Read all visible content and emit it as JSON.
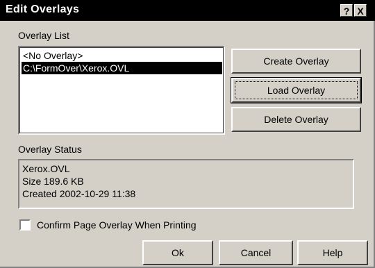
{
  "window": {
    "title": "Edit Overlays",
    "help_button": "?",
    "close_button": "X"
  },
  "overlay_list": {
    "label": "Overlay List",
    "items": [
      "<No Overlay>",
      "C:\\FormOver\\Xerox.OVL"
    ],
    "selected_index": 1
  },
  "side_buttons": {
    "create": "Create Overlay",
    "load": "Load Overlay",
    "delete": "Delete Overlay"
  },
  "status": {
    "label": "Overlay Status",
    "lines": [
      "Xerox.OVL",
      "Size 189.6 KB",
      "Created 2002-10-29 11:38"
    ]
  },
  "confirm": {
    "label": "Confirm Page Overlay When Printing",
    "checked": false
  },
  "footer": {
    "ok": "Ok",
    "cancel": "Cancel",
    "help": "Help"
  },
  "colors": {
    "titlebar_bg": "#000000",
    "dialog_bg": "#d4d0c8",
    "selection_bg": "#000000"
  },
  "icons": {
    "help_button": "question-mark",
    "close_button": "x-mark"
  }
}
